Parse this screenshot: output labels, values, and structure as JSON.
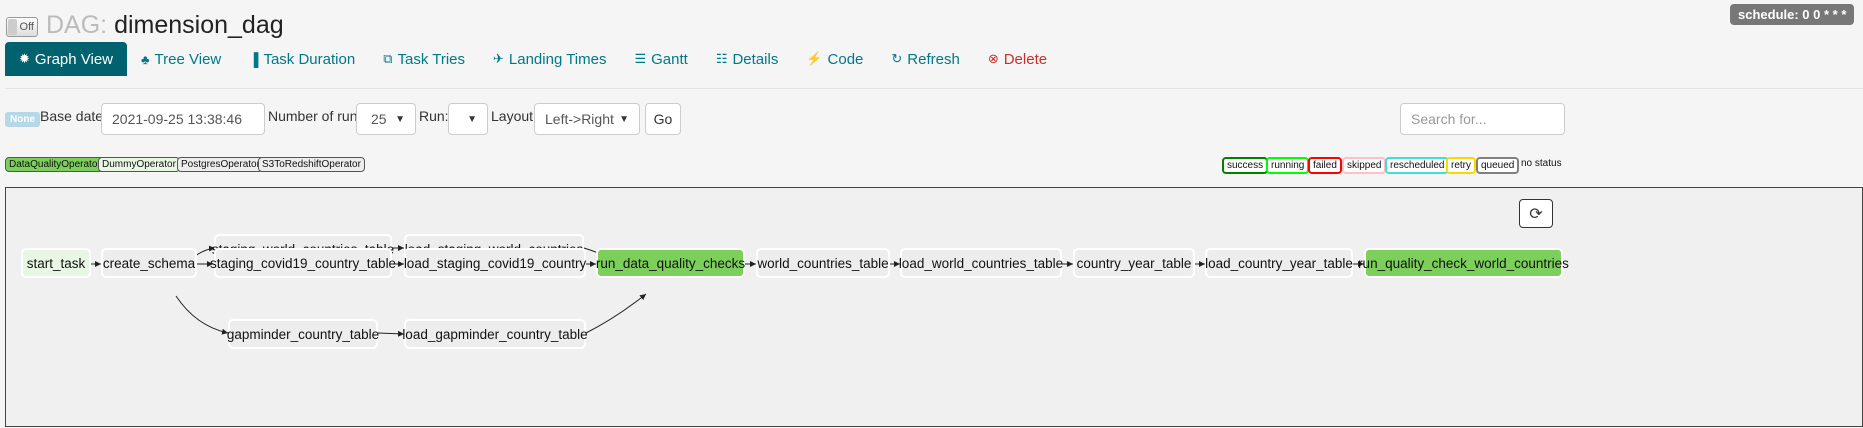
{
  "header": {
    "toggle_label": "Off",
    "title_prefix": "DAG:",
    "dag_id": "dimension_dag",
    "schedule": "schedule: 0 0 * * *"
  },
  "nav": [
    {
      "label": "Graph View",
      "icon": "asterisk-icon",
      "glyph": "✹"
    },
    {
      "label": "Tree View",
      "icon": "tree-icon",
      "glyph": "♣"
    },
    {
      "label": "Task Duration",
      "icon": "bar-chart-icon",
      "glyph": "▐"
    },
    {
      "label": "Task Tries",
      "icon": "duplicate-icon",
      "glyph": "⧉"
    },
    {
      "label": "Landing Times",
      "icon": "plane-icon",
      "glyph": "✈"
    },
    {
      "label": "Gantt",
      "icon": "align-left-icon",
      "glyph": "☰"
    },
    {
      "label": "Details",
      "icon": "list-icon",
      "glyph": "☷"
    },
    {
      "label": "Code",
      "icon": "flash-icon",
      "glyph": "⚡"
    },
    {
      "label": "Refresh",
      "icon": "refresh-icon",
      "glyph": "↻"
    },
    {
      "label": "Delete",
      "icon": "remove-circle-icon",
      "glyph": "⊗"
    }
  ],
  "controls": {
    "state_badge": "None",
    "base_date_label": "Base date:",
    "base_date": "2021-09-25 13:38:46",
    "num_runs_label": "Number of runs:",
    "num_runs": "25",
    "run_label": "Run:",
    "run_value": "",
    "layout_label": "Layout:",
    "layout_value": "Left->Right",
    "go_label": "Go",
    "search_placeholder": "Search for..."
  },
  "operators": [
    {
      "name": "DataQualityOperator",
      "color": "#7ccf5b"
    },
    {
      "name": "DummyOperator",
      "color": "#e8f7e4"
    },
    {
      "name": "PostgresOperator",
      "color": "#ededed"
    },
    {
      "name": "S3ToRedshiftOperator",
      "color": "#ededed"
    }
  ],
  "states": [
    {
      "name": "success",
      "color": "#008000"
    },
    {
      "name": "running",
      "color": "#00ff00"
    },
    {
      "name": "failed",
      "color": "#ff0000"
    },
    {
      "name": "skipped",
      "color": "#ffc0cb"
    },
    {
      "name": "rescheduled",
      "color": "#40e0d0"
    },
    {
      "name": "retry",
      "color": "#ffd700"
    },
    {
      "name": "queued",
      "color": "#808080"
    }
  ],
  "no_status_label": "no status",
  "graph": {
    "refresh_icon": "refresh-icon",
    "tasks": [
      {
        "id": "start_task",
        "operator": "DummyOperator"
      },
      {
        "id": "create_schema",
        "operator": "PostgresOperator"
      },
      {
        "id": "staging_world_countries_table",
        "operator": "PostgresOperator"
      },
      {
        "id": "load_staging_world_countries",
        "operator": "S3ToRedshiftOperator"
      },
      {
        "id": "staging_covid19_country_table",
        "operator": "PostgresOperator"
      },
      {
        "id": "load_staging_covid19_country",
        "operator": "S3ToRedshiftOperator"
      },
      {
        "id": "gapminder_country_table",
        "operator": "PostgresOperator"
      },
      {
        "id": "load_gapminder_country_table",
        "operator": "S3ToRedshiftOperator"
      },
      {
        "id": "run_data_quality_checks",
        "operator": "DataQualityOperator"
      },
      {
        "id": "world_countries_table",
        "operator": "PostgresOperator"
      },
      {
        "id": "load_world_countries_table",
        "operator": "PostgresOperator"
      },
      {
        "id": "country_year_table",
        "operator": "PostgresOperator"
      },
      {
        "id": "load_country_year_table",
        "operator": "PostgresOperator"
      },
      {
        "id": "run_quality_check_world_countries",
        "operator": "DataQualityOperator"
      }
    ]
  }
}
